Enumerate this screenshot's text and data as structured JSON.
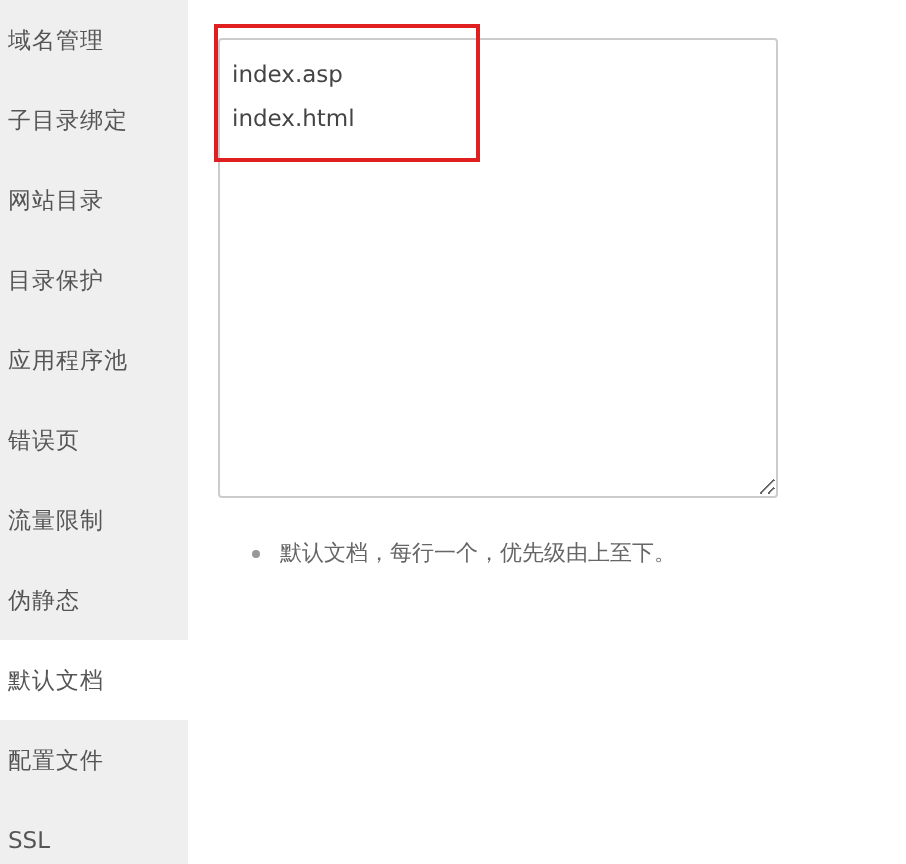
{
  "sidebar": {
    "items": [
      {
        "label": "域名管理",
        "selected": false
      },
      {
        "label": "子目录绑定",
        "selected": false
      },
      {
        "label": "网站目录",
        "selected": false
      },
      {
        "label": "目录保护",
        "selected": false
      },
      {
        "label": "应用程序池",
        "selected": false
      },
      {
        "label": "错误页",
        "selected": false
      },
      {
        "label": "流量限制",
        "selected": false
      },
      {
        "label": "伪静态",
        "selected": false
      },
      {
        "label": "默认文档",
        "selected": true
      },
      {
        "label": "配置文件",
        "selected": false
      },
      {
        "label": "SSL",
        "selected": false
      }
    ]
  },
  "editor": {
    "value": "index.asp\nindex.html"
  },
  "notes": [
    "默认文档，每行一个，优先级由上至下。"
  ]
}
